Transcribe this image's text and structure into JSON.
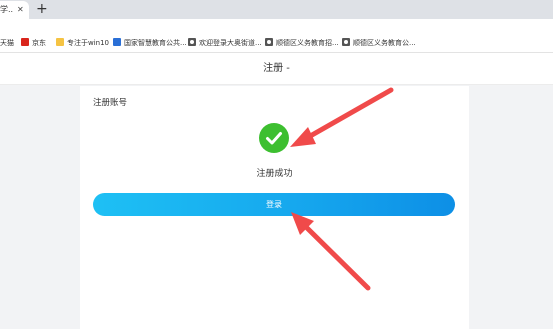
{
  "browser": {
    "tab": {
      "title": "学..."
    },
    "bookmarks": [
      {
        "label": "天猫",
        "icon": "none"
      },
      {
        "label": "京东",
        "icon": "jd-icon"
      },
      {
        "label": "专注于win10",
        "icon": "folder-icon"
      },
      {
        "label": "国家智慧教育公共...",
        "icon": "education-icon"
      },
      {
        "label": "欢迎登录大奥街道...",
        "icon": "globe-icon"
      },
      {
        "label": "顺德区义务教育招...",
        "icon": "globe-icon"
      },
      {
        "label": "顺德区义务教育公...",
        "icon": "globe-icon"
      }
    ]
  },
  "page": {
    "title": "注册 -",
    "card_heading": "注册账号",
    "success_text": "注册成功",
    "login_label": "登录"
  },
  "colors": {
    "success_green": "#3dbf30",
    "button_blue": "#16a8ee",
    "annotation_red": "#f04a4a"
  }
}
